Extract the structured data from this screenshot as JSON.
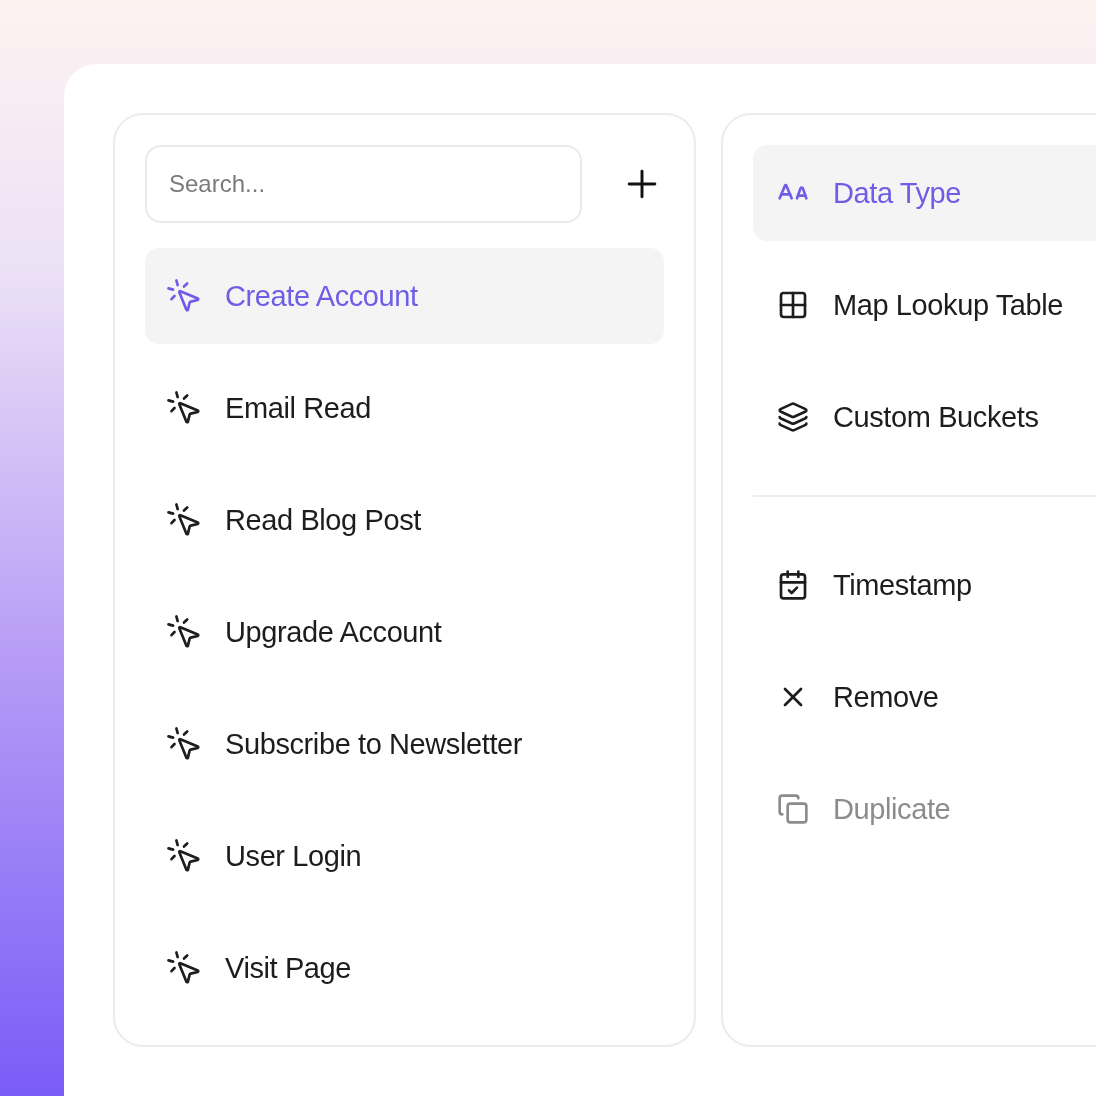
{
  "search": {
    "placeholder": "Search..."
  },
  "events": [
    {
      "label": "Create Account",
      "selected": true
    },
    {
      "label": "Email Read",
      "selected": false
    },
    {
      "label": "Read Blog Post",
      "selected": false
    },
    {
      "label": "Upgrade Account",
      "selected": false
    },
    {
      "label": "Subscribe to Newsletter",
      "selected": false
    },
    {
      "label": "User Login",
      "selected": false
    },
    {
      "label": "Visit Page",
      "selected": false
    }
  ],
  "menu_groups": [
    {
      "items": [
        {
          "label": "Data Type",
          "selected": true,
          "disabled": false
        },
        {
          "label": "Map Lookup Table",
          "selected": false,
          "disabled": false
        },
        {
          "label": "Custom Buckets",
          "selected": false,
          "disabled": false
        }
      ]
    },
    {
      "items": [
        {
          "label": "Timestamp",
          "selected": false,
          "disabled": false
        },
        {
          "label": "Remove",
          "selected": false,
          "disabled": false
        },
        {
          "label": "Duplicate",
          "selected": false,
          "disabled": true
        }
      ]
    }
  ]
}
